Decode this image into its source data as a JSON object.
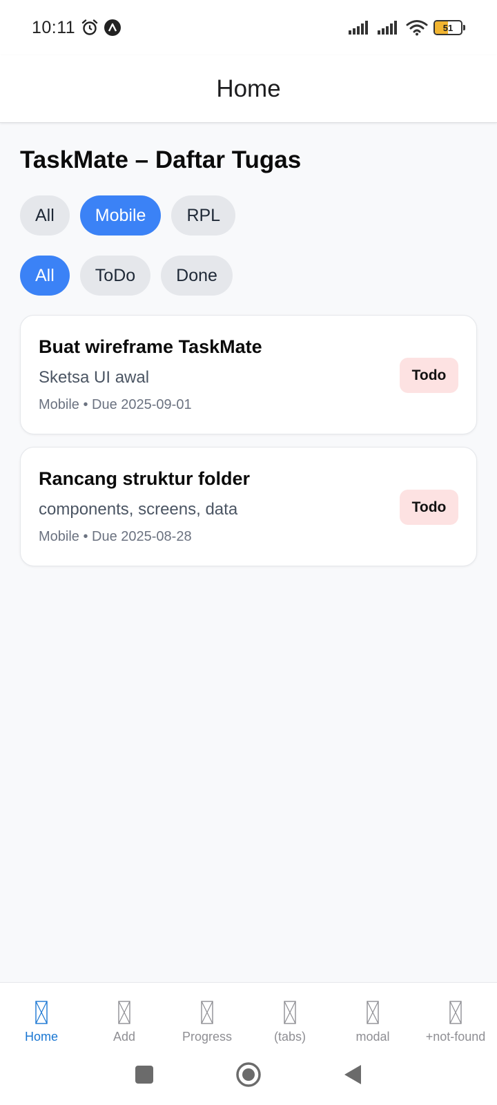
{
  "status_bar": {
    "time": "10:11",
    "battery_level": "51",
    "battery_fraction": 0.51,
    "icons": [
      "alarm-icon",
      "a-icon",
      "signal-icon",
      "signal-icon",
      "wifi-icon",
      "battery-icon"
    ]
  },
  "header": {
    "title": "Home"
  },
  "page": {
    "title": "TaskMate – Daftar Tugas"
  },
  "category_filters": [
    {
      "label": "All",
      "active": false
    },
    {
      "label": "Mobile",
      "active": true
    },
    {
      "label": "RPL",
      "active": false
    }
  ],
  "status_filters": [
    {
      "label": "All",
      "active": true
    },
    {
      "label": "ToDo",
      "active": false
    },
    {
      "label": "Done",
      "active": false
    }
  ],
  "tasks": [
    {
      "title": "Buat wireframe TaskMate",
      "description": "Sketsa UI awal",
      "meta": "Mobile • Due 2025-09-01",
      "status": "Todo"
    },
    {
      "title": "Rancang struktur folder",
      "description": "components, screens, data",
      "meta": "Mobile • Due 2025-08-28",
      "status": "Todo"
    }
  ],
  "tabs": [
    {
      "label": "Home",
      "active": true
    },
    {
      "label": "Add",
      "active": false
    },
    {
      "label": "Progress",
      "active": false
    },
    {
      "label": "(tabs)",
      "active": false
    },
    {
      "label": "modal",
      "active": false
    },
    {
      "label": "+not-found",
      "active": false
    }
  ],
  "colors": {
    "accent": "#3b82f6",
    "tab_active": "#1976d2",
    "badge_todo_bg": "#fde2e2",
    "battery": "#f2b531"
  },
  "nav": {
    "icons": [
      "recents-icon",
      "home-icon",
      "back-icon"
    ]
  }
}
